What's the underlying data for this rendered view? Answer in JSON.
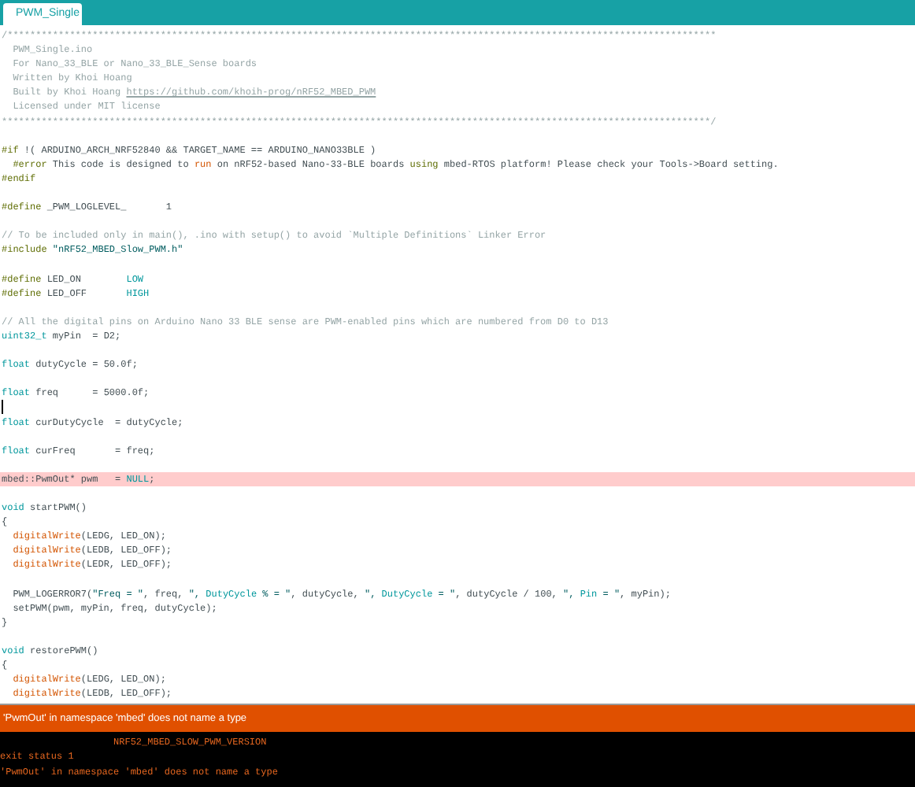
{
  "tabs": [
    {
      "label": "PWM_Single",
      "selected": true
    }
  ],
  "code": [
    {
      "kind": "code",
      "segments": [
        {
          "kind": "comment",
          "text": "/*****************************************************************************************************************************"
        }
      ]
    },
    {
      "kind": "code",
      "segments": [
        {
          "kind": "comment",
          "text": "  PWM_Single.ino"
        }
      ]
    },
    {
      "kind": "code",
      "segments": [
        {
          "kind": "comment",
          "text": "  For Nano_33_BLE or Nano_33_BLE_Sense boards"
        }
      ]
    },
    {
      "kind": "code",
      "segments": [
        {
          "kind": "comment",
          "text": "  Written by Khoi Hoang"
        }
      ]
    },
    {
      "kind": "code",
      "segments": [
        {
          "kind": "comment",
          "text": "  Built by Khoi Hoang "
        },
        {
          "kind": "url",
          "text": "https://github.com/khoih-prog/nRF52_MBED_PWM"
        }
      ]
    },
    {
      "kind": "code",
      "segments": [
        {
          "kind": "comment",
          "text": "  Licensed under MIT license"
        }
      ]
    },
    {
      "kind": "code",
      "segments": [
        {
          "kind": "comment",
          "text": "*****************************************************************************************************************************/"
        }
      ]
    },
    {
      "kind": "blank"
    },
    {
      "kind": "code",
      "segments": [
        {
          "kind": "preproc",
          "text": "#if"
        },
        {
          "kind": "plain",
          "text": " !( ARDUINO_ARCH_NRF52840 && TARGET_NAME == ARDUINO_NANO33BLE )"
        }
      ]
    },
    {
      "kind": "code",
      "segments": [
        {
          "kind": "preproc",
          "text": "  #error"
        },
        {
          "kind": "plain",
          "text": " This code is designed to "
        },
        {
          "kind": "function",
          "text": "run"
        },
        {
          "kind": "plain",
          "text": " on nRF52-based Nano-33-BLE boards "
        },
        {
          "kind": "preproc",
          "text": "using"
        },
        {
          "kind": "plain",
          "text": " mbed-RTOS platform! Please check your Tools->Board setting."
        }
      ]
    },
    {
      "kind": "code",
      "segments": [
        {
          "kind": "preproc",
          "text": "#endif"
        }
      ]
    },
    {
      "kind": "blank"
    },
    {
      "kind": "code",
      "segments": [
        {
          "kind": "preproc",
          "text": "#define"
        },
        {
          "kind": "plain",
          "text": " _PWM_LOGLEVEL_       1"
        }
      ]
    },
    {
      "kind": "blank"
    },
    {
      "kind": "code",
      "segments": [
        {
          "kind": "comment",
          "text": "// To be included only in main(), .ino with setup() to avoid `Multiple Definitions` Linker Error"
        }
      ]
    },
    {
      "kind": "code",
      "segments": [
        {
          "kind": "preproc",
          "text": "#include"
        },
        {
          "kind": "string",
          "text": " \"nRF52_MBED_Slow_PWM.h\""
        }
      ]
    },
    {
      "kind": "blank"
    },
    {
      "kind": "code",
      "segments": [
        {
          "kind": "preproc",
          "text": "#define"
        },
        {
          "kind": "plain",
          "text": " LED_ON        "
        },
        {
          "kind": "keyword",
          "text": "LOW"
        }
      ]
    },
    {
      "kind": "code",
      "segments": [
        {
          "kind": "preproc",
          "text": "#define"
        },
        {
          "kind": "plain",
          "text": " LED_OFF       "
        },
        {
          "kind": "keyword",
          "text": "HIGH"
        }
      ]
    },
    {
      "kind": "blank"
    },
    {
      "kind": "code",
      "segments": [
        {
          "kind": "comment",
          "text": "// All the digital pins on Arduino Nano 33 BLE sense are PWM-enabled pins which are numbered from D0 to D13"
        }
      ]
    },
    {
      "kind": "code",
      "segments": [
        {
          "kind": "keyword",
          "text": "uint32_t"
        },
        {
          "kind": "plain",
          "text": " myPin  = D2;"
        }
      ]
    },
    {
      "kind": "blank"
    },
    {
      "kind": "code",
      "segments": [
        {
          "kind": "keyword",
          "text": "float"
        },
        {
          "kind": "plain",
          "text": " dutyCycle = 50.0f;"
        }
      ]
    },
    {
      "kind": "blank"
    },
    {
      "kind": "code",
      "segments": [
        {
          "kind": "keyword",
          "text": "float"
        },
        {
          "kind": "plain",
          "text": " freq      = 5000.0f;"
        }
      ]
    },
    {
      "kind": "blank",
      "cursor": true
    },
    {
      "kind": "code",
      "segments": [
        {
          "kind": "keyword",
          "text": "float"
        },
        {
          "kind": "plain",
          "text": " curDutyCycle  = dutyCycle;"
        }
      ]
    },
    {
      "kind": "blank"
    },
    {
      "kind": "code",
      "segments": [
        {
          "kind": "keyword",
          "text": "float"
        },
        {
          "kind": "plain",
          "text": " curFreq       = freq;"
        }
      ]
    },
    {
      "kind": "blank"
    },
    {
      "kind": "code",
      "highlighted": true,
      "segments": [
        {
          "kind": "plain",
          "text": "mbed::PwmOut* pwm   = "
        },
        {
          "kind": "keyword",
          "text": "NULL"
        },
        {
          "kind": "plain",
          "text": ";"
        }
      ]
    },
    {
      "kind": "blank"
    },
    {
      "kind": "code",
      "segments": [
        {
          "kind": "keyword",
          "text": "void"
        },
        {
          "kind": "plain",
          "text": " startPWM()"
        }
      ]
    },
    {
      "kind": "code",
      "segments": [
        {
          "kind": "plain",
          "text": "{"
        }
      ]
    },
    {
      "kind": "code",
      "segments": [
        {
          "kind": "function",
          "text": "  digitalWrite"
        },
        {
          "kind": "plain",
          "text": "(LEDG, LED_ON);"
        }
      ]
    },
    {
      "kind": "code",
      "segments": [
        {
          "kind": "function",
          "text": "  digitalWrite"
        },
        {
          "kind": "plain",
          "text": "(LEDB, LED_OFF);"
        }
      ]
    },
    {
      "kind": "code",
      "segments": [
        {
          "kind": "function",
          "text": "  digitalWrite"
        },
        {
          "kind": "plain",
          "text": "(LEDR, LED_OFF);"
        }
      ]
    },
    {
      "kind": "blank"
    },
    {
      "kind": "code",
      "segments": [
        {
          "kind": "plain",
          "text": "  PWM_LOGERROR7("
        },
        {
          "kind": "string",
          "text": "\"Freq = \""
        },
        {
          "kind": "plain",
          "text": ", freq, "
        },
        {
          "kind": "string",
          "text": "\", "
        },
        {
          "kind": "keyword",
          "text": "DutyCycle"
        },
        {
          "kind": "string",
          "text": " % = \""
        },
        {
          "kind": "plain",
          "text": ", dutyCycle, "
        },
        {
          "kind": "string",
          "text": "\", "
        },
        {
          "kind": "keyword",
          "text": "DutyCycle"
        },
        {
          "kind": "string",
          "text": " = \""
        },
        {
          "kind": "plain",
          "text": ", dutyCycle / 100, "
        },
        {
          "kind": "string",
          "text": "\", "
        },
        {
          "kind": "keyword",
          "text": "Pin"
        },
        {
          "kind": "string",
          "text": " = \""
        },
        {
          "kind": "plain",
          "text": ", myPin);"
        }
      ]
    },
    {
      "kind": "code",
      "segments": [
        {
          "kind": "plain",
          "text": "  setPWM(pwm, myPin, freq, dutyCycle);"
        }
      ]
    },
    {
      "kind": "code",
      "segments": [
        {
          "kind": "plain",
          "text": "}"
        }
      ]
    },
    {
      "kind": "blank"
    },
    {
      "kind": "code",
      "segments": [
        {
          "kind": "keyword",
          "text": "void"
        },
        {
          "kind": "plain",
          "text": " restorePWM()"
        }
      ]
    },
    {
      "kind": "code",
      "segments": [
        {
          "kind": "plain",
          "text": "{"
        }
      ]
    },
    {
      "kind": "code",
      "segments": [
        {
          "kind": "function",
          "text": "  digitalWrite"
        },
        {
          "kind": "plain",
          "text": "(LEDG, LED_ON);"
        }
      ]
    },
    {
      "kind": "code",
      "segments": [
        {
          "kind": "function",
          "text": "  digitalWrite"
        },
        {
          "kind": "plain",
          "text": "(LEDB, LED_OFF);"
        }
      ]
    }
  ],
  "error_bar": {
    "message": "'PwmOut' in namespace 'mbed' does not name a type"
  },
  "console": [
    "                    NRF52_MBED_SLOW_PWM_VERSION",
    "exit status 1",
    "'PwmOut' in namespace 'mbed' does not name a type"
  ]
}
